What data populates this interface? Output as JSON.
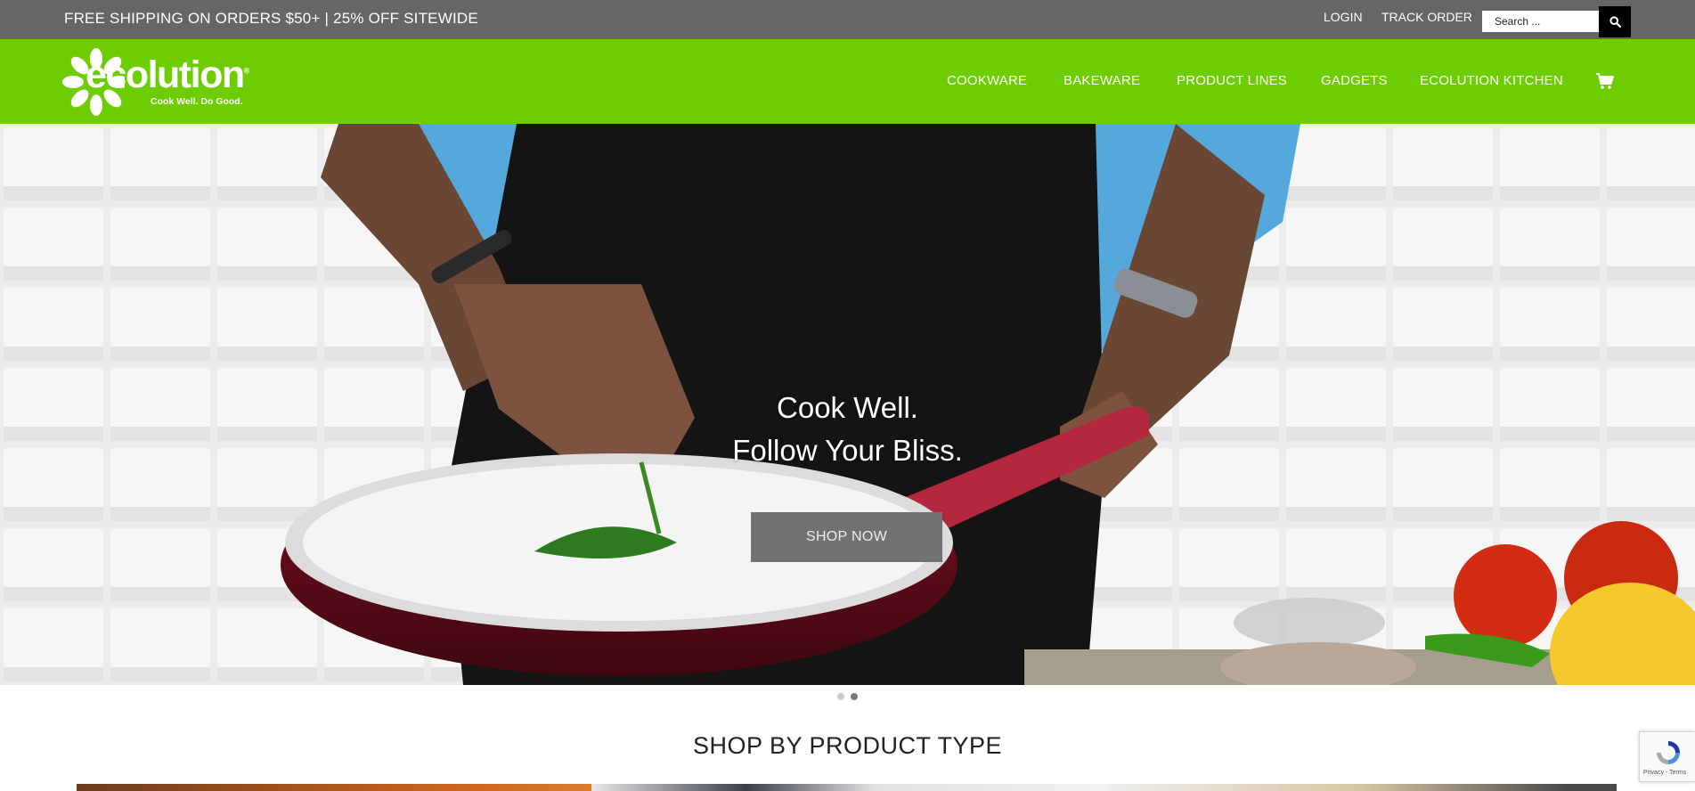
{
  "topbar": {
    "promo": "FREE SHIPPING ON ORDERS $50+ | 25% OFF SITEWIDE",
    "login": "LOGIN",
    "track_order": "TRACK ORDER",
    "search_placeholder": "Search ...",
    "search_icon": "search-icon"
  },
  "header": {
    "logo_word": "ecolution",
    "logo_mark": "®",
    "logo_tagline": "Cook Well. Do Good.",
    "nav": [
      "COOKWARE",
      "BAKEWARE",
      "PRODUCT LINES",
      "GADGETS",
      "ECOLUTION KITCHEN"
    ],
    "cart_icon": "cart-icon",
    "brand_color": "#6ecd00"
  },
  "hero": {
    "line1": "Cook Well.",
    "line2": "Follow Your Bliss.",
    "cta": "SHOP NOW",
    "slides_total": 2,
    "active_slide": 2
  },
  "section": {
    "title": "SHOP BY PRODUCT TYPE"
  },
  "recaptcha": {
    "text": "Privacy - Terms"
  }
}
